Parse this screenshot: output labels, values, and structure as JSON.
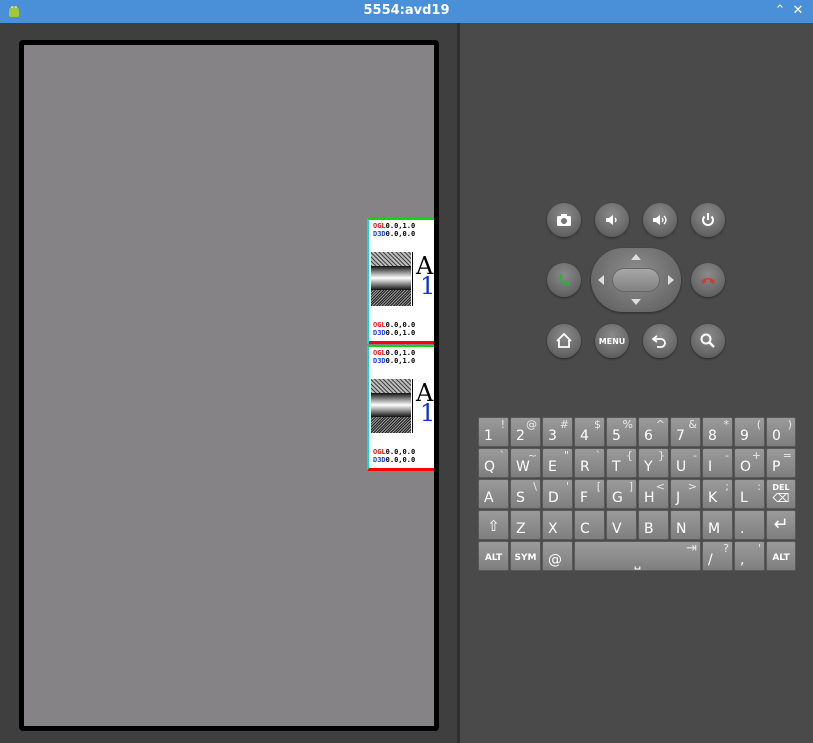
{
  "window": {
    "title": "5554:avd19",
    "minimize_glyph": "⌃",
    "close_glyph": "✕",
    "app_icon": "android-icon"
  },
  "screen": {
    "background": "#858385",
    "tiles": [
      {
        "top_label": {
          "api1": "OGL",
          "val1": "0.0,1.0",
          "api2": "D3D",
          "val2": "0.0,0.0"
        },
        "glyph_letter": "A",
        "glyph_number": "1",
        "bottom_label": {
          "api1": "OGL",
          "val1": "0.0,0.0",
          "api2": "D3D",
          "val2": "0.0,1.0"
        }
      },
      {
        "top_label": {
          "api1": "OGL",
          "val1": "0.0,1.0",
          "api2": "D3D",
          "val2": "0.0,1.0"
        },
        "glyph_letter": "A",
        "glyph_number": "1",
        "bottom_label": {
          "api1": "OGL",
          "val1": "0.0,0.0",
          "api2": "D3D",
          "val2": "0.0,0.0"
        }
      }
    ]
  },
  "controls": {
    "camera": "camera-icon",
    "volume_down": "volume-down-icon",
    "volume_up": "volume-up-icon",
    "power": "power-icon",
    "call": "call-icon",
    "end_call": "end-call-icon",
    "home": "home-icon",
    "menu_label": "MENU",
    "back": "back-icon",
    "search": "search-icon"
  },
  "keyboard": {
    "row1": [
      {
        "main": "1",
        "alt": "!"
      },
      {
        "main": "2",
        "alt": "@"
      },
      {
        "main": "3",
        "alt": "#"
      },
      {
        "main": "4",
        "alt": "$"
      },
      {
        "main": "5",
        "alt": "%"
      },
      {
        "main": "6",
        "alt": "^"
      },
      {
        "main": "7",
        "alt": "&"
      },
      {
        "main": "8",
        "alt": "*"
      },
      {
        "main": "9",
        "alt": "("
      },
      {
        "main": "0",
        "alt": ")"
      }
    ],
    "row2": [
      {
        "main": "Q",
        "alt": "`"
      },
      {
        "main": "W",
        "alt": "~"
      },
      {
        "main": "E",
        "alt": "\""
      },
      {
        "main": "R",
        "alt": "`"
      },
      {
        "main": "T",
        "alt": "{"
      },
      {
        "main": "Y",
        "alt": "}"
      },
      {
        "main": "U",
        "alt": "-"
      },
      {
        "main": "I",
        "alt": "-"
      },
      {
        "main": "O",
        "alt": "+"
      },
      {
        "main": "P",
        "alt": "="
      }
    ],
    "row3": [
      {
        "main": "A",
        "alt": ""
      },
      {
        "main": "S",
        "alt": "\\"
      },
      {
        "main": "D",
        "alt": "'"
      },
      {
        "main": "F",
        "alt": "["
      },
      {
        "main": "G",
        "alt": "]"
      },
      {
        "main": "H",
        "alt": "<"
      },
      {
        "main": "J",
        "alt": ">"
      },
      {
        "main": "K",
        "alt": ";"
      },
      {
        "main": "L",
        "alt": ":"
      },
      {
        "main": "DEL",
        "alt": ""
      }
    ],
    "row4": [
      {
        "main": "⇧",
        "alt": ""
      },
      {
        "main": "Z",
        "alt": ""
      },
      {
        "main": "X",
        "alt": ""
      },
      {
        "main": "C",
        "alt": ""
      },
      {
        "main": "V",
        "alt": ""
      },
      {
        "main": "B",
        "alt": ""
      },
      {
        "main": "N",
        "alt": ""
      },
      {
        "main": "M",
        "alt": ""
      },
      {
        "main": ".",
        "alt": ""
      },
      {
        "main": "↵",
        "alt": ""
      }
    ],
    "row5": {
      "alt_left": "ALT",
      "sym": "SYM",
      "at": "@",
      "space_glyph": "⎵",
      "tab_glyph": "⇥",
      "slash": "/",
      "slash_alt": "?",
      "comma": ",",
      "comma_alt": "'",
      "alt_right": "ALT"
    }
  }
}
